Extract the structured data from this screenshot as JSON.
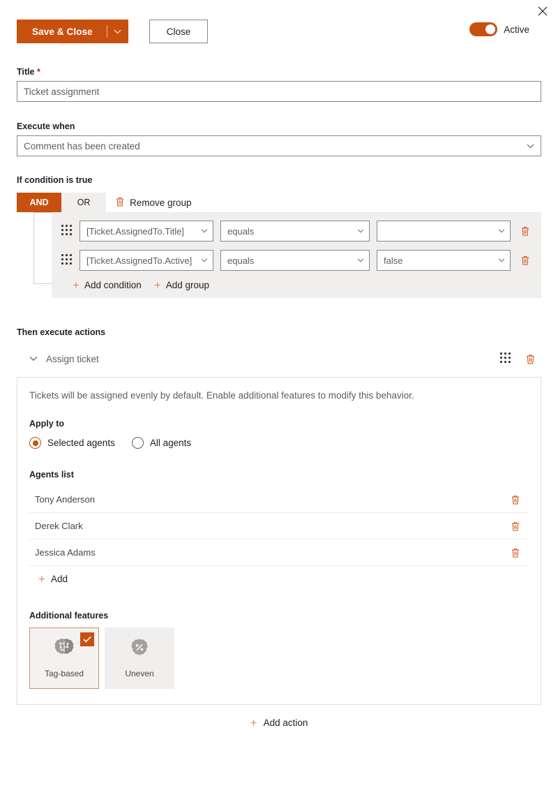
{
  "header": {
    "close_icon": "close-icon",
    "save_label": "Save & Close",
    "save_caret_icon": "chevron-down-icon",
    "close_label": "Close",
    "toggle_label": "Active",
    "toggle_state": "on",
    "accent_color": "#c8500f"
  },
  "title_field": {
    "label": "Title",
    "required_marker": "*",
    "value": "Ticket assignment"
  },
  "execute_when": {
    "label": "Execute when",
    "value": "Comment has been created",
    "chevron_icon": "chevron-down-icon"
  },
  "condition": {
    "label": "If condition is true",
    "logic": {
      "and_label": "AND",
      "or_label": "OR",
      "selected": "AND"
    },
    "remove_group_label": "Remove group",
    "remove_group_icon": "trash-icon",
    "rows": [
      {
        "drag_icon": "drag-handle-icon",
        "field": "[Ticket.AssignedTo.Title]",
        "operator": "equals",
        "value": "",
        "delete_icon": "trash-icon"
      },
      {
        "drag_icon": "drag-handle-icon",
        "field": "[Ticket.AssignedTo.Active]",
        "operator": "equals",
        "value": "false",
        "delete_icon": "trash-icon"
      }
    ],
    "add_condition_label": "Add condition",
    "add_group_label": "Add group",
    "plus_icon": "plus-icon"
  },
  "actions": {
    "label": "Then execute actions",
    "action": {
      "collapse_icon": "chevron-down-icon",
      "title": "Assign ticket",
      "drag_icon": "drag-handle-icon",
      "delete_icon": "trash-icon",
      "hint": "Tickets will be assigned evenly by default. Enable additional features to modify this behavior.",
      "apply_to": {
        "label": "Apply to",
        "options": [
          {
            "label": "Selected agents",
            "selected": true
          },
          {
            "label": "All agents",
            "selected": false
          }
        ]
      },
      "agents": {
        "label": "Agents list",
        "items": [
          {
            "name": "Tony Anderson",
            "delete_icon": "trash-icon"
          },
          {
            "name": "Derek Clark",
            "delete_icon": "trash-icon"
          },
          {
            "name": "Jessica Adams",
            "delete_icon": "trash-icon"
          }
        ],
        "add_label": "Add",
        "plus_icon": "plus-icon"
      },
      "features": {
        "label": "Additional features",
        "cards": [
          {
            "label": "Tag-based",
            "icon": "brain-circuit-icon",
            "enabled": true,
            "check_icon": "check-icon"
          },
          {
            "label": "Uneven",
            "icon": "percent-badge-icon",
            "enabled": false
          }
        ]
      }
    },
    "add_action_label": "Add action",
    "add_action_icon": "plus-icon"
  }
}
